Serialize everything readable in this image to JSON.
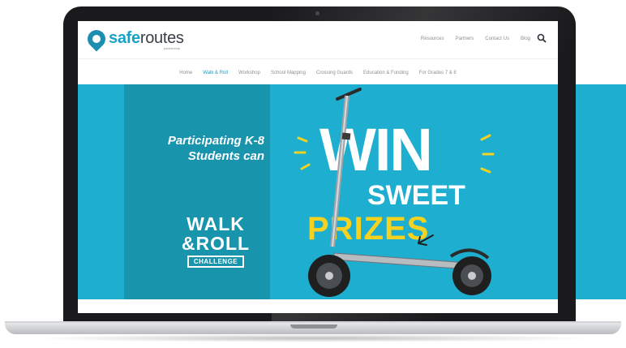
{
  "brand": {
    "name_part1": "safe",
    "name_part2": "routes",
    "subtitle": "partnership",
    "accent_color": "#17a3c8",
    "hero_color": "#1eaecf",
    "hero_dark_color": "#1994ad",
    "prize_color": "#f4d21f"
  },
  "utility_nav": [
    "Resources",
    "Partners",
    "Contact Us",
    "Blog"
  ],
  "main_nav": [
    {
      "label": "Home",
      "active": false
    },
    {
      "label": "Walk & Roll",
      "active": true
    },
    {
      "label": "Workshop",
      "active": false
    },
    {
      "label": "School Mapping",
      "active": false
    },
    {
      "label": "Crossing Guards",
      "active": false
    },
    {
      "label": "Education & Funding",
      "active": false
    },
    {
      "label": "For Grades 7 & 8",
      "active": false
    }
  ],
  "hero": {
    "tagline_line1": "Participating K-8",
    "tagline_line2": "Students can",
    "walk_roll_line1": "WALK",
    "walk_roll_line2": "&ROLL",
    "walk_roll_line3": "CHALLENGE",
    "win": "WIN",
    "sweet": "SWEET",
    "prizes": "PRIZES"
  },
  "icons": {
    "search": "search-icon",
    "logo": "map-pin-icon",
    "scooter": "kick-scooter-icon"
  }
}
